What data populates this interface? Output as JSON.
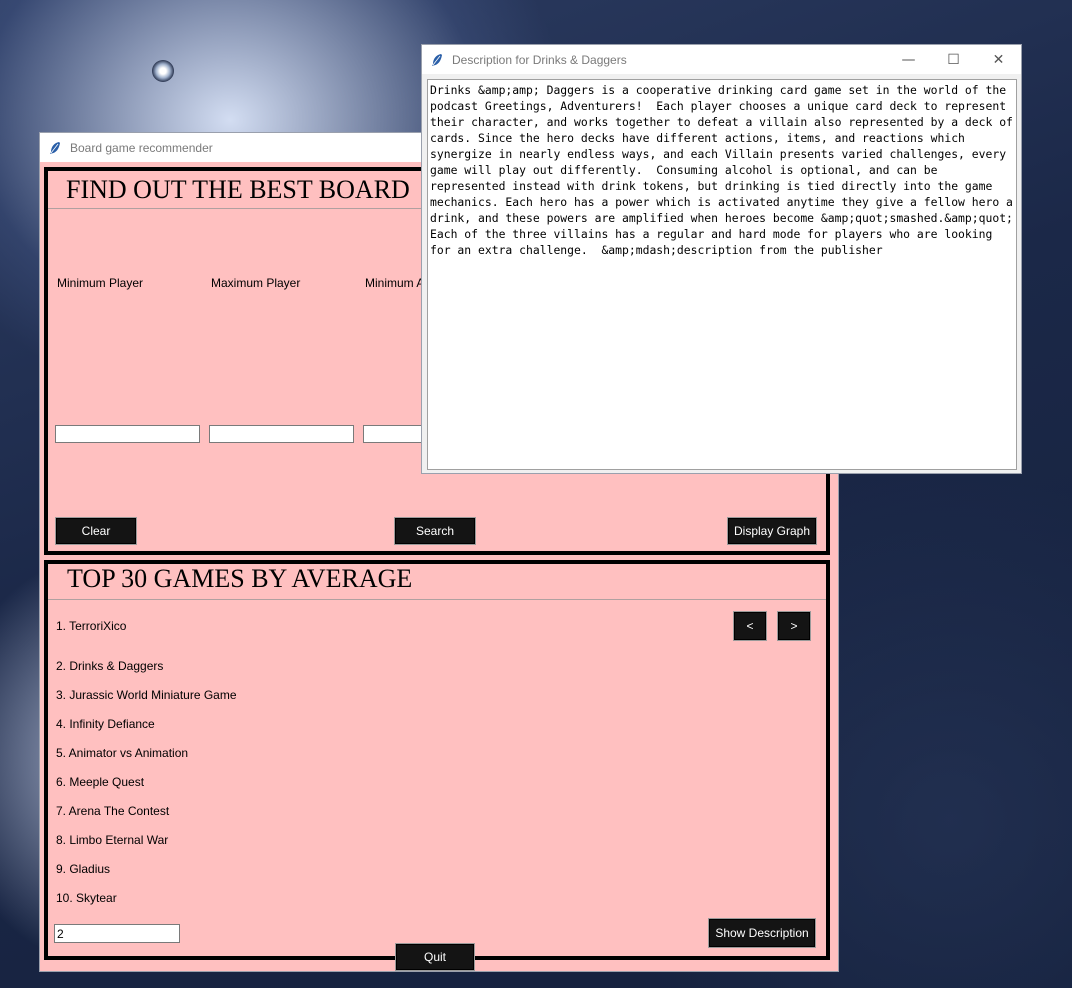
{
  "main_window": {
    "title": "Board game recommender",
    "finder": {
      "heading": "FIND OUT THE BEST BOARD",
      "labels": [
        "Minimum Player",
        "Maximum Player",
        "Minimum A"
      ],
      "inputs": [
        "",
        "",
        ""
      ],
      "buttons": {
        "clear": "Clear",
        "search": "Search",
        "graph": "Display Graph"
      }
    },
    "top": {
      "heading": "TOP 30 GAMES BY AVERAGE",
      "prev": "<",
      "next": ">",
      "items": [
        "1. TerroriXico",
        "2. Drinks & Daggers",
        "3. Jurassic World Miniature Game",
        "4. Infinity Defiance",
        "5. Animator vs Animation",
        "6. Meeple Quest",
        "7. Arena  The Contest",
        "8. Limbo  Eternal War",
        "9. Gladius",
        "10. Skytear"
      ],
      "selection_value": "2",
      "show_description": "Show Description"
    },
    "quit": "Quit"
  },
  "desc_window": {
    "title": "Description for Drinks & Daggers",
    "controls": {
      "minimize": "—",
      "maximize": "☐",
      "close": "✕"
    },
    "text": "Drinks &amp;amp; Daggers is a cooperative drinking card game set in the world of the podcast Greetings, Adventurers!  Each player chooses a unique card deck to represent their character, and works together to defeat a villain also represented by a deck of cards. Since the hero decks have different actions, items, and reactions which synergize in nearly endless ways, and each Villain presents varied challenges, every game will play out differently.  Consuming alcohol is optional, and can be represented instead with drink tokens, but drinking is tied directly into the game mechanics. Each hero has a power which is activated anytime they give a fellow hero a drink, and these powers are amplified when heroes become &amp;quot;smashed.&amp;quot; Each of the three villains has a regular and hard mode for players who are looking for an extra challenge.  &amp;mdash;description from the publisher"
  },
  "colors": {
    "window_bg": "#ffc0c0",
    "button_bg": "#141414",
    "frame_border": "#000000"
  }
}
